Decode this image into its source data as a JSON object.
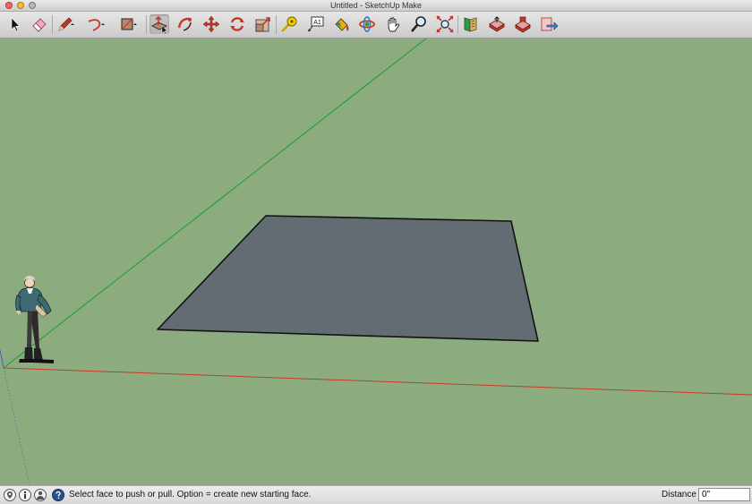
{
  "window": {
    "title": "Untitled - SketchUp Make"
  },
  "toolbar": {
    "tools": [
      {
        "name": "select",
        "icon": "select-arrow-icon"
      },
      {
        "name": "eraser",
        "icon": "eraser-icon"
      },
      {
        "name": "pencil",
        "icon": "pencil-icon"
      },
      {
        "name": "arc",
        "icon": "arc-icon"
      },
      {
        "name": "rectangle",
        "icon": "rectangle-icon"
      },
      {
        "name": "push-pull",
        "icon": "push-pull-icon",
        "active": true
      },
      {
        "name": "follow-me",
        "icon": "follow-me-icon"
      },
      {
        "name": "move",
        "icon": "move-icon"
      },
      {
        "name": "rotate",
        "icon": "rotate-icon"
      },
      {
        "name": "scale",
        "icon": "scale-icon"
      },
      {
        "name": "tape-measure",
        "icon": "tape-measure-icon"
      },
      {
        "name": "text",
        "icon": "text-label-icon",
        "label": "A1"
      },
      {
        "name": "paint-bucket",
        "icon": "paint-bucket-icon"
      },
      {
        "name": "orbit",
        "icon": "orbit-icon"
      },
      {
        "name": "pan",
        "icon": "pan-hand-icon"
      },
      {
        "name": "zoom",
        "icon": "zoom-icon"
      },
      {
        "name": "zoom-extents",
        "icon": "zoom-extents-icon"
      },
      {
        "name": "get-models",
        "icon": "get-models-icon"
      },
      {
        "name": "share-model",
        "icon": "share-model-icon"
      },
      {
        "name": "extension-warehouse",
        "icon": "extension-warehouse-icon"
      },
      {
        "name": "send-to-layout",
        "icon": "send-to-layout-icon"
      }
    ]
  },
  "viewport": {
    "background_color": "#8cac7f",
    "face_color": "#636b73",
    "axis_colors": {
      "red": "#c23a28",
      "green": "#1a9e2a",
      "blue": "#3b5fcf"
    }
  },
  "statusbar": {
    "icons": [
      "geolocation-icon",
      "credits-icon",
      "user-icon",
      "help-icon"
    ],
    "message": "Select face to push or pull.  Option = create new starting face.",
    "vcb_label": "Distance",
    "vcb_value": "0\""
  }
}
